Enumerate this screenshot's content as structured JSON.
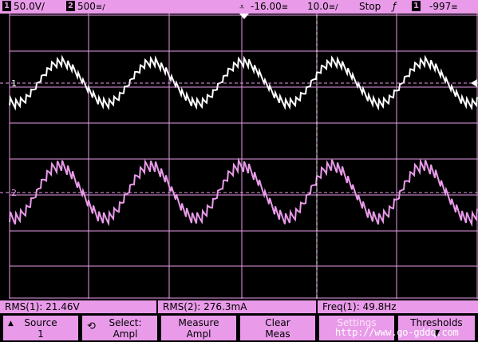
{
  "status": {
    "ch1_number": "1",
    "ch1_scale": "50.0V/",
    "ch2_number": "2",
    "ch2_scale": "500",
    "ch2_unit_glyph": "≡/",
    "trigger_delay": "-16.00",
    "trigger_delay_unit": "≡",
    "time_scale": "10.0",
    "time_scale_unit": "≡/",
    "run_state": "Stop",
    "trigger_slope_icon": "rising-edge-icon",
    "trigger_slope_glyph": "ƒ",
    "trigger_source": "1",
    "trigger_level": "-997",
    "trigger_level_unit": "≡"
  },
  "plot": {
    "ch1_marker": "1",
    "ch2_marker": "2",
    "ch1_color": "#ffffff",
    "ch2_color": "#e99be9",
    "grid_color": "#e99be9",
    "background": "#000000"
  },
  "measurements": [
    {
      "label": "RMS(1): 21.46V"
    },
    {
      "label": "RMS(2): 276.3mA"
    },
    {
      "label": "Freq(1): 49.8Hz"
    }
  ],
  "softkeys": {
    "source": {
      "line1": "Source",
      "line2": "1",
      "icon": "up-arrow-icon"
    },
    "select": {
      "line1": "Select:",
      "line2": "Ampl",
      "icon": "rotary-knob-icon"
    },
    "measure": {
      "line1": "Measure",
      "line2": "Ampl"
    },
    "clear": {
      "line1": "Clear",
      "line2": "Meas"
    },
    "settings": {
      "line1": "Settings"
    },
    "thresholds": {
      "line1": "Thresholds",
      "icon": "down-arrow-icon"
    }
  },
  "watermark": "http://www.go-gddq.com"
}
